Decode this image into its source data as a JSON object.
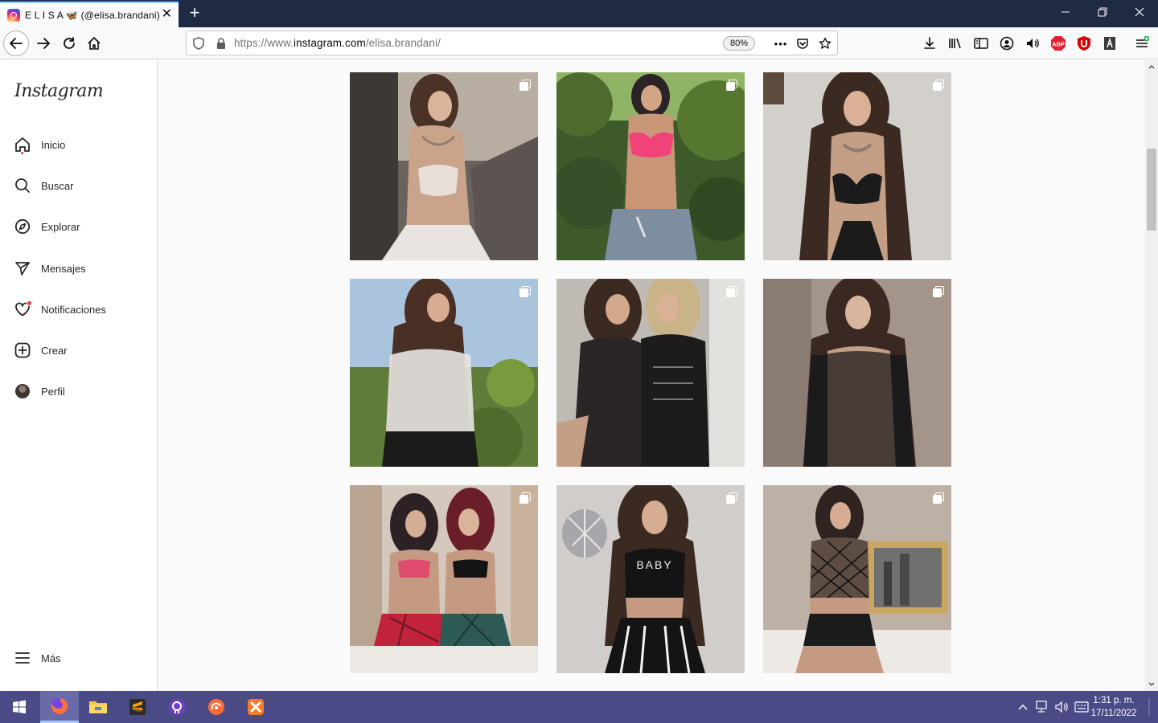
{
  "browser": {
    "tab_title": "E L I S A 🦋 (@elisa.brandani) • ",
    "tab_close": "✕",
    "new_tab": "+",
    "window_controls": {
      "minimize": "—",
      "restore": "❐",
      "close": "✕"
    },
    "url_prefix": "https://www.",
    "url_domain": "instagram.com",
    "url_path": "/elisa.brandani/",
    "zoom": "80%",
    "page_actions": "•••",
    "abp_label": "ABP"
  },
  "instagram": {
    "logo": "Instagram",
    "nav": [
      {
        "label": "Inicio",
        "icon": "home-icon"
      },
      {
        "label": "Buscar",
        "icon": "search-icon"
      },
      {
        "label": "Explorar",
        "icon": "compass-icon"
      },
      {
        "label": "Mensajes",
        "icon": "send-icon"
      },
      {
        "label": "Notificaciones",
        "icon": "heart-icon"
      },
      {
        "label": "Crear",
        "icon": "plus-square-icon"
      },
      {
        "label": "Perfil",
        "icon": "avatar"
      }
    ],
    "more_label": "Más",
    "posts": [
      {
        "type": "carousel"
      },
      {
        "type": "carousel"
      },
      {
        "type": "carousel"
      },
      {
        "type": "carousel"
      },
      {
        "type": "carousel"
      },
      {
        "type": "carousel"
      },
      {
        "type": "carousel"
      },
      {
        "type": "carousel"
      },
      {
        "type": "carousel"
      }
    ],
    "post8_print": "BABY"
  },
  "taskbar": {
    "apps": [
      "windows-start-icon",
      "firefox-icon",
      "file-explorer-icon",
      "sublime-text-icon",
      "github-desktop-icon",
      "postman-icon",
      "xampp-icon"
    ],
    "time": "1:31 p. m.",
    "date": "17/11/2022"
  }
}
